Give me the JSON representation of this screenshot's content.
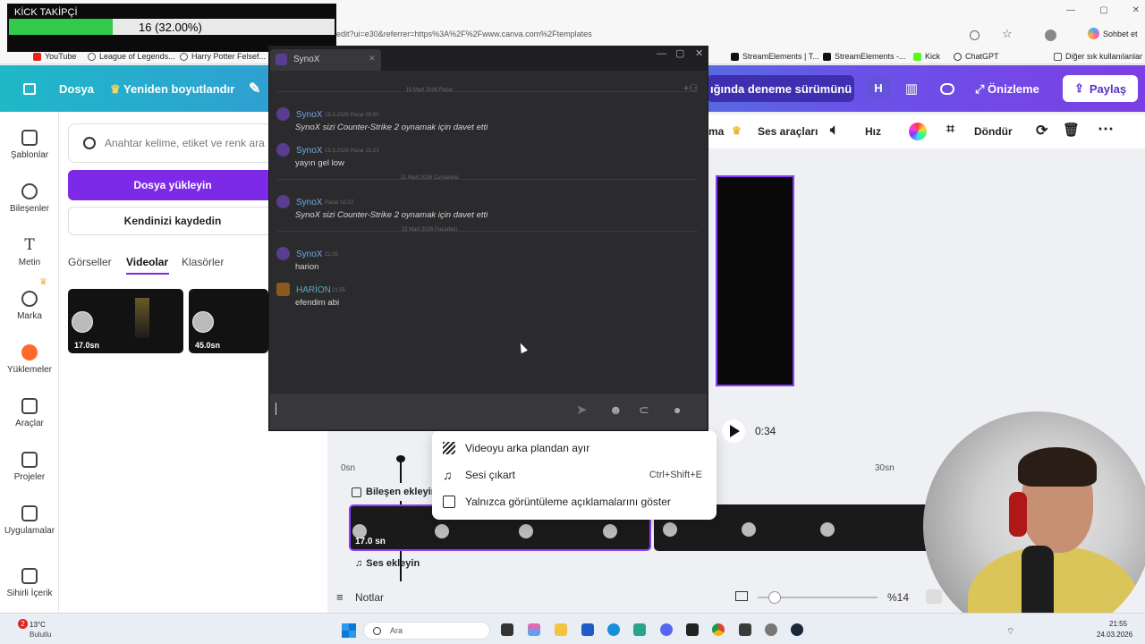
{
  "browser": {
    "url": "edit?ui=e30&referrer=https%3A%2F%2Fwww.canva.com%2Ftemplates",
    "chat_label": "Sohbet et",
    "bookmarks": [
      "YouTube",
      "League of Legends...",
      "Harry Potter Felsef...",
      "StreamElements | T...",
      "StreamElements -...",
      "Kick",
      "ChatGPT"
    ],
    "other_bookmarks": "Diğer sık kullanılanlar"
  },
  "stream_overlay": {
    "title": "KİCK TAKİPÇİ",
    "count": "16 (32.00%)",
    "progress": 0.32
  },
  "canva_header": {
    "file": "Dosya",
    "resize": "Yeniden boyutlandır",
    "trial_banner": "ığında deneme sürümünü ...",
    "avatar": "H",
    "preview": "Önizleme",
    "share": "Paylaş"
  },
  "rail": [
    {
      "label": "Şablonlar"
    },
    {
      "label": "Bileşenler"
    },
    {
      "label": "Metin"
    },
    {
      "label": "Marka"
    },
    {
      "label": "Yüklemeler"
    },
    {
      "label": "Araçlar"
    },
    {
      "label": "Projeler"
    },
    {
      "label": "Uygulamalar"
    },
    {
      "label": "Sihirli İçerik"
    }
  ],
  "side_panel": {
    "search_placeholder": "Anahtar kelime, etiket ve renk ara",
    "upload": "Dosya yükleyin",
    "record": "Kendinizi kaydedin",
    "tabs": [
      "Görseller",
      "Videolar",
      "Klasörler"
    ],
    "thumbs": [
      "17.0sn",
      "45.0sn"
    ]
  },
  "editor_toolbar": {
    "crop_partial": "ma",
    "audio_tools": "Ses araçları",
    "speed": "Hız",
    "rotate": "Döndür"
  },
  "player": {
    "time": "0:34"
  },
  "timeline": {
    "ruler_start": "0sn",
    "ruler_end": "30sn",
    "add_elements": "Bileşen ekleyin",
    "clip_duration": "17.0 sn",
    "add_audio": "Ses ekleyin"
  },
  "bottom_bar": {
    "notes": "Notlar",
    "zoom": "%14",
    "zoom_level": 0.14
  },
  "context_menu": [
    {
      "label": "Videoyu arka plandan ayır",
      "shortcut": ""
    },
    {
      "label": "Sesi çıkart",
      "shortcut": "Ctrl+Shift+E"
    },
    {
      "label": "Yalnızca görüntüleme açıklamalarını göster",
      "shortcut": ""
    }
  ],
  "chat": {
    "window_title": "SynoX",
    "separators": [
      "15 Mart 2026 Pazar",
      "21 Mart 2026 Cumartesi",
      "23 Mart 2026 Pazartesi"
    ],
    "messages": [
      {
        "name": "SynoX",
        "meta": "15.3.2026 Pazar 03:50",
        "text": "SynoX sizi  Counter-Strike 2 oynamak için davet etti",
        "italic": true
      },
      {
        "name": "SynoX",
        "meta": "15.3.2026 Pazar 21:21",
        "text": "yayın gel low",
        "italic": false
      },
      {
        "name": "SynoX",
        "meta": "Pazar 02:07",
        "text": "SynoX sizi  Counter-Strike 2 oynamak için davet etti",
        "italic": true
      },
      {
        "name": "SynoX",
        "meta": "21:55",
        "text": "harion",
        "italic": false
      },
      {
        "name": "HARİON",
        "meta": "21:55",
        "text": "efendim abi",
        "italic": false
      }
    ]
  },
  "taskbar": {
    "weather_temp": "13°C",
    "weather_desc": "Bulutlu",
    "search": "Ara",
    "time": "21:55",
    "date": "24.03.2026",
    "notification_count": "2"
  }
}
